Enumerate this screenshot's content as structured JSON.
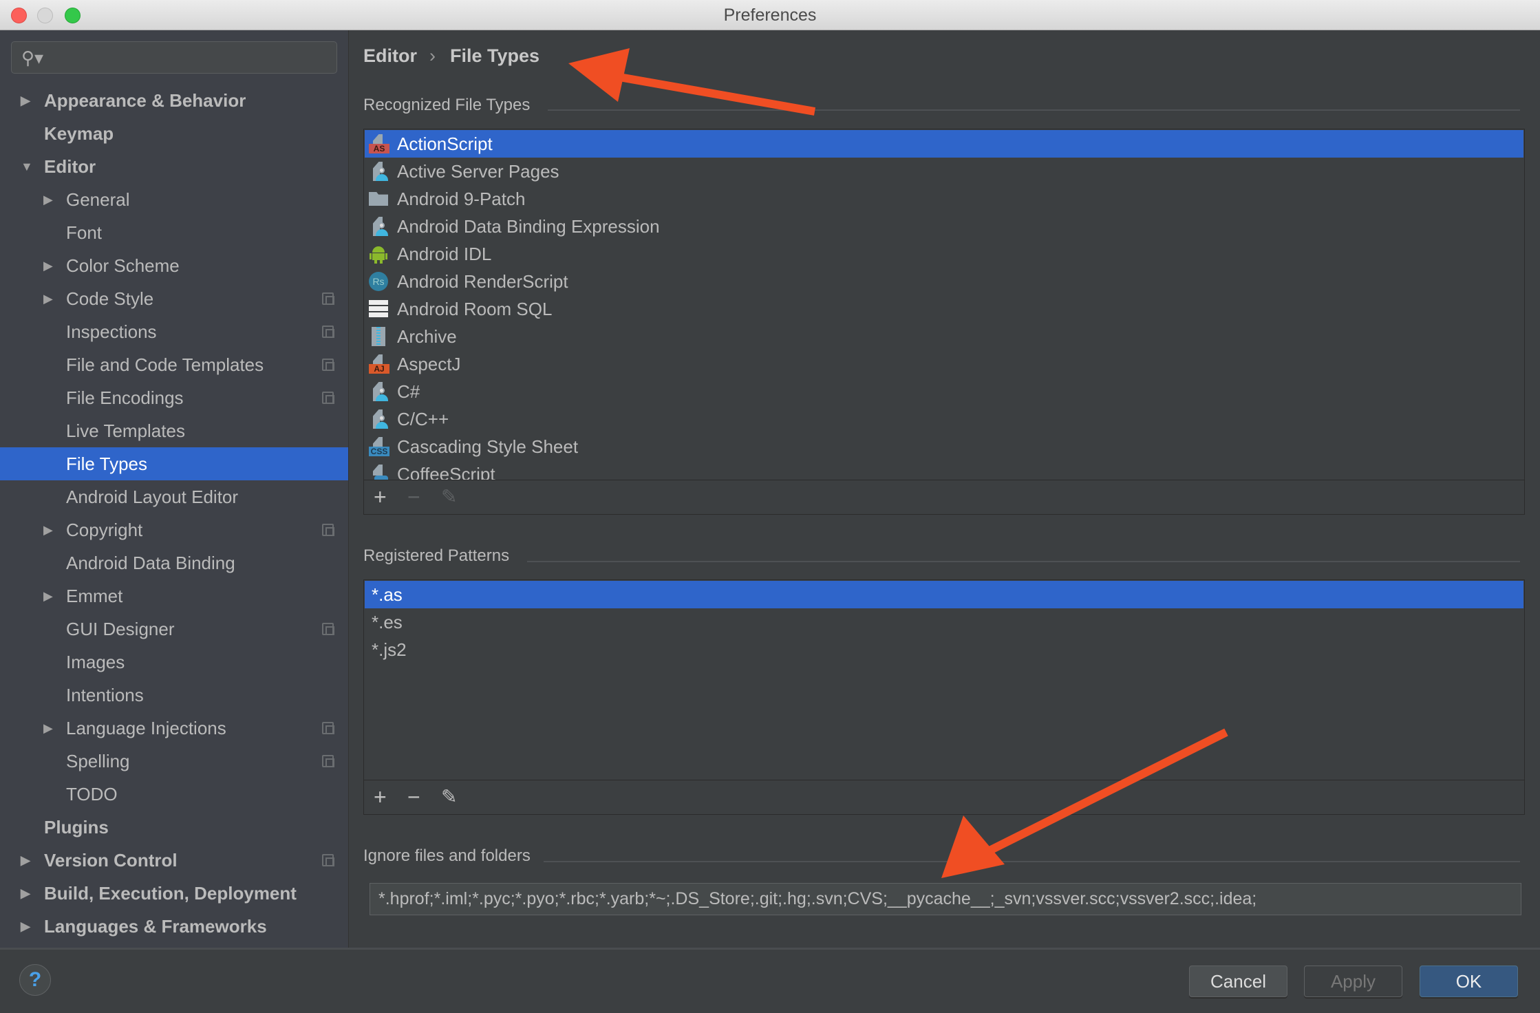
{
  "window": {
    "title": "Preferences"
  },
  "search": {
    "placeholder": "",
    "icon": "search-icon"
  },
  "tree": [
    {
      "label": "Appearance & Behavior",
      "level": 0,
      "arrow": "right",
      "bold": true
    },
    {
      "label": "Keymap",
      "level": 0,
      "arrow": "none",
      "bold": true
    },
    {
      "label": "Editor",
      "level": 0,
      "arrow": "down",
      "bold": true
    },
    {
      "label": "General",
      "level": 1,
      "arrow": "right"
    },
    {
      "label": "Font",
      "level": 1,
      "arrow": "none"
    },
    {
      "label": "Color Scheme",
      "level": 1,
      "arrow": "right"
    },
    {
      "label": "Code Style",
      "level": 1,
      "arrow": "right",
      "copy": true
    },
    {
      "label": "Inspections",
      "level": 1,
      "arrow": "none",
      "copy": true
    },
    {
      "label": "File and Code Templates",
      "level": 1,
      "arrow": "none",
      "copy": true
    },
    {
      "label": "File Encodings",
      "level": 1,
      "arrow": "none",
      "copy": true
    },
    {
      "label": "Live Templates",
      "level": 1,
      "arrow": "none"
    },
    {
      "label": "File Types",
      "level": 1,
      "arrow": "none",
      "selected": true
    },
    {
      "label": "Android Layout Editor",
      "level": 1,
      "arrow": "none"
    },
    {
      "label": "Copyright",
      "level": 1,
      "arrow": "right",
      "copy": true
    },
    {
      "label": "Android Data Binding",
      "level": 1,
      "arrow": "none"
    },
    {
      "label": "Emmet",
      "level": 1,
      "arrow": "right"
    },
    {
      "label": "GUI Designer",
      "level": 1,
      "arrow": "none",
      "copy": true
    },
    {
      "label": "Images",
      "level": 1,
      "arrow": "none"
    },
    {
      "label": "Intentions",
      "level": 1,
      "arrow": "none"
    },
    {
      "label": "Language Injections",
      "level": 1,
      "arrow": "right",
      "copy": true
    },
    {
      "label": "Spelling",
      "level": 1,
      "arrow": "none",
      "copy": true
    },
    {
      "label": "TODO",
      "level": 1,
      "arrow": "none"
    },
    {
      "label": "Plugins",
      "level": 0,
      "arrow": "none",
      "bold": true
    },
    {
      "label": "Version Control",
      "level": 0,
      "arrow": "right",
      "bold": true,
      "copy": true
    },
    {
      "label": "Build, Execution, Deployment",
      "level": 0,
      "arrow": "right",
      "bold": true
    },
    {
      "label": "Languages & Frameworks",
      "level": 0,
      "arrow": "right",
      "bold": true
    }
  ],
  "breadcrumb": {
    "parent": "Editor",
    "separator": "›",
    "current": "File Types"
  },
  "recognized": {
    "label": "Recognized File Types",
    "items": [
      {
        "label": "ActionScript",
        "icon": "as",
        "icon_text": "AS",
        "selected": true
      },
      {
        "label": "Active Server Pages",
        "icon": "person"
      },
      {
        "label": "Android 9-Patch",
        "icon": "folder"
      },
      {
        "label": "Android Data Binding Expression",
        "icon": "person"
      },
      {
        "label": "Android IDL",
        "icon": "android"
      },
      {
        "label": "Android RenderScript",
        "icon": "rs",
        "icon_text": "Rs"
      },
      {
        "label": "Android Room SQL",
        "icon": "table"
      },
      {
        "label": "Archive",
        "icon": "archive"
      },
      {
        "label": "AspectJ",
        "icon": "aj",
        "icon_text": "AJ"
      },
      {
        "label": "C#",
        "icon": "person"
      },
      {
        "label": "C/C++",
        "icon": "person"
      },
      {
        "label": "Cascading Style Sheet",
        "icon": "css",
        "icon_text": "CSS"
      },
      {
        "label": "CoffeeScript",
        "icon": "coffee"
      }
    ]
  },
  "patterns": {
    "label": "Registered Patterns",
    "items": [
      {
        "label": "*.as",
        "selected": true
      },
      {
        "label": "*.es"
      },
      {
        "label": "*.js2"
      }
    ]
  },
  "toolbar_labels": {
    "add": "+",
    "remove": "−",
    "edit": "✎"
  },
  "ignore": {
    "label": "Ignore files and folders",
    "value": "*.hprof;*.iml;*.pyc;*.pyo;*.rbc;*.yarb;*~;.DS_Store;.git;.hg;.svn;CVS;__pycache__;_svn;vssver.scc;vssver2.scc;.idea;"
  },
  "buttons": {
    "help": "?",
    "cancel": "Cancel",
    "apply": "Apply",
    "ok": "OK"
  },
  "colors": {
    "selection": "#2f65ca",
    "annotation_arrow": "#f04e23",
    "ok_button": "#365880"
  }
}
